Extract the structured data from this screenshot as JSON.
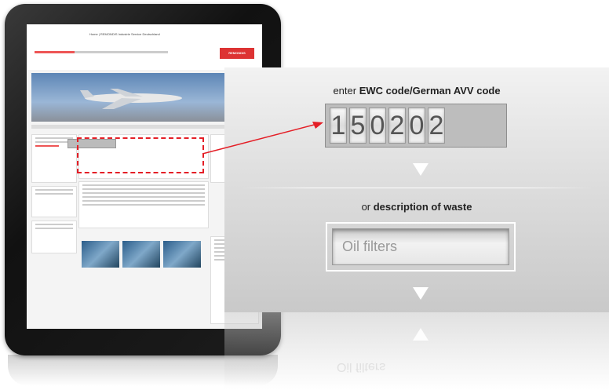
{
  "website": {
    "title": "Home | REMONDIS Industrie Service Deutschland",
    "logo": "REMONDIS"
  },
  "panel": {
    "code_prompt_prefix": "enter ",
    "code_prompt_bold": "EWC code/German AVV code",
    "code_digits": [
      "1",
      "5",
      "0",
      "2",
      "0",
      "2"
    ],
    "or_prefix": "or ",
    "description_bold": "description of waste",
    "description_value": "Oil filters",
    "reflection_text": "Oil filters"
  },
  "colors": {
    "highlight": "#e41e26",
    "panel_top": "#f2f2f2",
    "panel_bottom": "#c9c9c9"
  }
}
